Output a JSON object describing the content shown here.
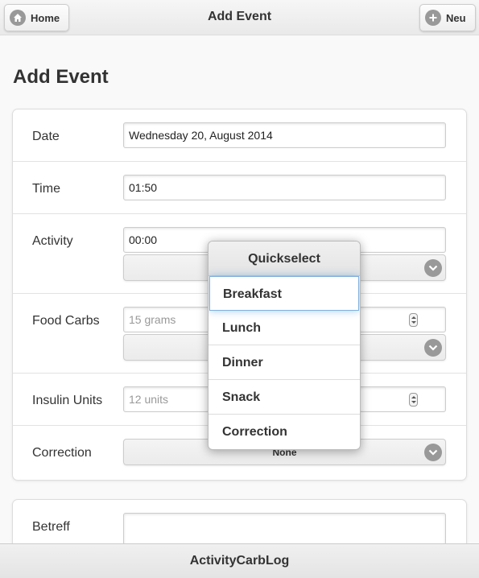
{
  "header": {
    "title": "Add Event",
    "home_label": "Home",
    "new_label": "Neu"
  },
  "page_title": "Add Event",
  "form": {
    "date": {
      "label": "Date",
      "value": "Wednesday 20, August 2014"
    },
    "time": {
      "label": "Time",
      "value": "01:50"
    },
    "activity": {
      "label": "Activity",
      "value": "00:00",
      "select_value": ""
    },
    "food_carbs": {
      "label": "Food Carbs",
      "placeholder": "15 grams",
      "select_value": ""
    },
    "insulin_units": {
      "label": "Insulin Units",
      "placeholder": "12 units"
    },
    "correction": {
      "label": "Correction",
      "select_value": "None"
    },
    "betreff": {
      "label": "Betreff",
      "value": ""
    }
  },
  "quickselect": {
    "title": "Quickselect",
    "items": [
      "Breakfast",
      "Lunch",
      "Dinner",
      "Snack",
      "Correction"
    ],
    "active_index": 0
  },
  "footer": {
    "title": "ActivityCarbLog"
  },
  "icons": {
    "home": "home-icon",
    "add": "plus-circle-icon",
    "chevron": "chevron-down-icon"
  },
  "colors": {
    "icon_bg": "#999999",
    "highlight": "#7fb0de"
  }
}
